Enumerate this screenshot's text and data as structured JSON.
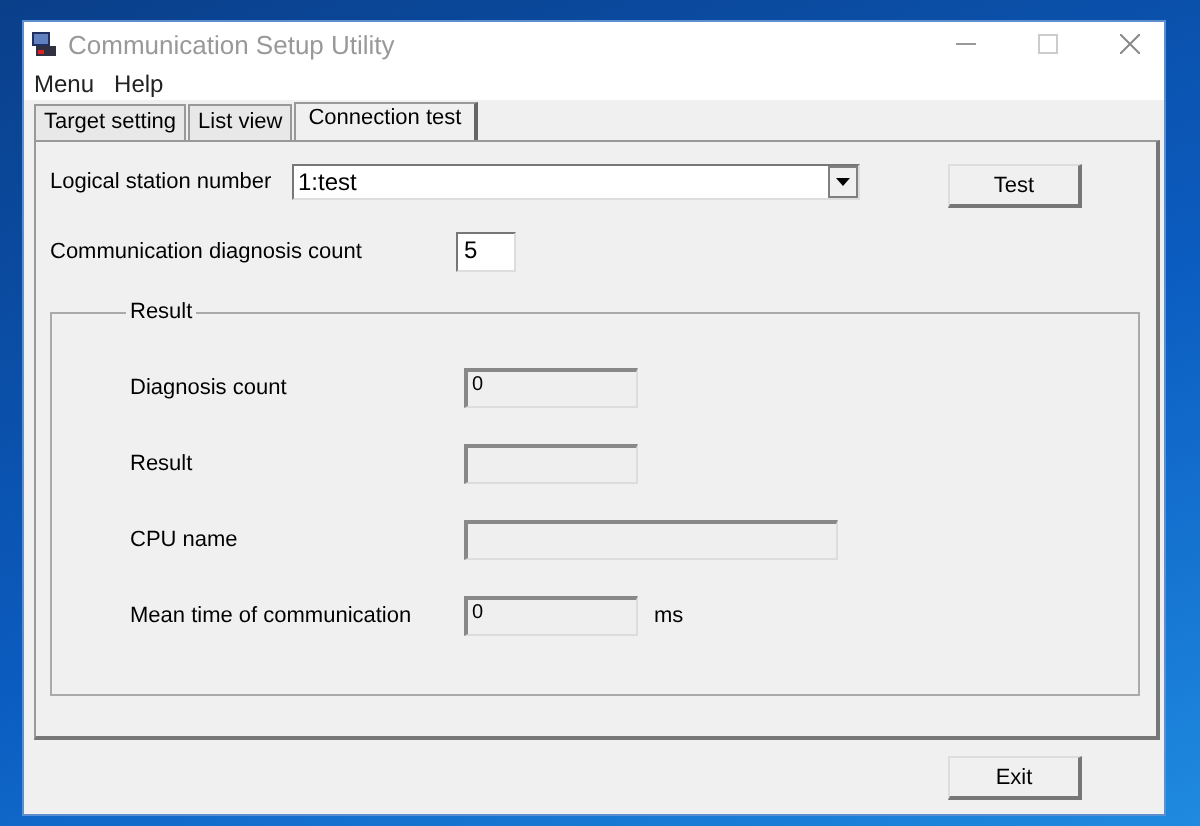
{
  "window": {
    "title": "Communication Setup Utility"
  },
  "menu": [
    {
      "label": "Menu"
    },
    {
      "label": "Help"
    }
  ],
  "tabs": [
    {
      "label": "Target setting",
      "selected": false
    },
    {
      "label": "List view",
      "selected": false
    },
    {
      "label": "Connection test",
      "selected": true
    }
  ],
  "logical_station": {
    "label": "Logical station number",
    "value": "1:test"
  },
  "test_button": "Test",
  "diagnosis_count_setting": {
    "label": "Communication diagnosis count",
    "value": "5"
  },
  "result_group": {
    "title": "Result",
    "fields": [
      {
        "label": "Diagnosis count",
        "value": "0",
        "wide": false
      },
      {
        "label": "Result",
        "wide": false
      },
      {
        "label": "CPU name",
        "wide": true
      },
      {
        "label": "Mean time of communication",
        "value": "0",
        "unit": "ms",
        "wide": false
      }
    ]
  },
  "exit_button": "Exit"
}
